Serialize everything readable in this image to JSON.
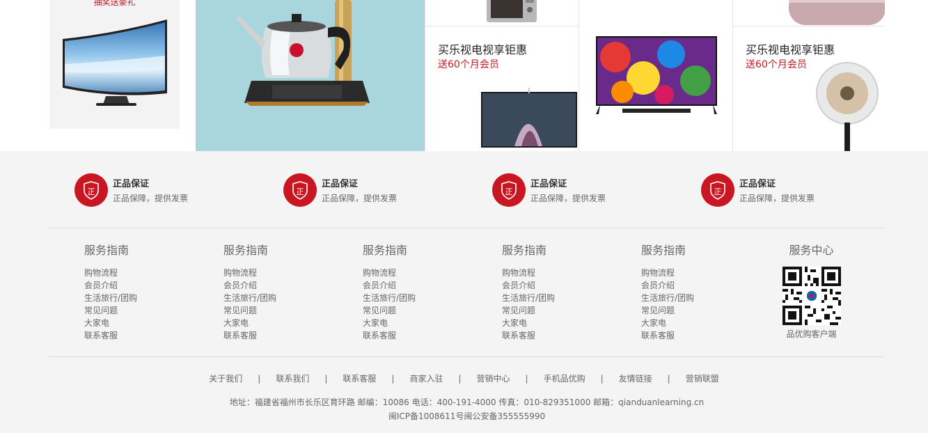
{
  "products": {
    "curved_tv": {
      "promo": "抽奖送豪礼"
    },
    "cell_tv_left": {
      "title": "买乐视电视享钜惠",
      "subtitle": "送60个月会员"
    },
    "cell_tv_right": {
      "title": "买乐视电视享钜惠",
      "subtitle": "送60个月会员"
    }
  },
  "guarantees": [
    {
      "icon": "正",
      "title": "正品保证",
      "desc": "正品保障，提供发票"
    },
    {
      "icon": "正",
      "title": "正品保证",
      "desc": "正品保障，提供发票"
    },
    {
      "icon": "正",
      "title": "正品保证",
      "desc": "正品保障，提供发票"
    },
    {
      "icon": "正",
      "title": "正品保证",
      "desc": "正品保障，提供发票"
    }
  ],
  "guide_columns": [
    {
      "title": "服务指南",
      "links": [
        "购物流程",
        "会员介绍",
        "生活旅行/团购",
        "常见问题",
        "大家电",
        "联系客服"
      ]
    },
    {
      "title": "服务指南",
      "links": [
        "购物流程",
        "会员介绍",
        "生活旅行/团购",
        "常见问题",
        "大家电",
        "联系客服"
      ]
    },
    {
      "title": "服务指南",
      "links": [
        "购物流程",
        "会员介绍",
        "生活旅行/团购",
        "常见问题",
        "大家电",
        "联系客服"
      ]
    },
    {
      "title": "服务指南",
      "links": [
        "购物流程",
        "会员介绍",
        "生活旅行/团购",
        "常见问题",
        "大家电",
        "联系客服"
      ]
    },
    {
      "title": "服务指南",
      "links": [
        "购物流程",
        "会员介绍",
        "生活旅行/团购",
        "常见问题",
        "大家电",
        "联系客服"
      ]
    }
  ],
  "service_center": {
    "title": "服务中心",
    "qr_caption": "品优购客户端"
  },
  "bottom_links": [
    "关于我们",
    "联系我们",
    "联系客服",
    "商家入驻",
    "营销中心",
    "手机品优购",
    "友情链接",
    "营销联盟"
  ],
  "separator": "|",
  "address": "地址：福建省福州市长乐区育环路 邮编：10086 电话：400-191-4000 传真：010-829351000 邮箱：qianduanlearning.cn",
  "icp": "闽ICP备1008611号闽公安备355555990",
  "colors": {
    "accent": "#c81623",
    "footer_bg": "#f4f4f4",
    "text": "#666666"
  }
}
